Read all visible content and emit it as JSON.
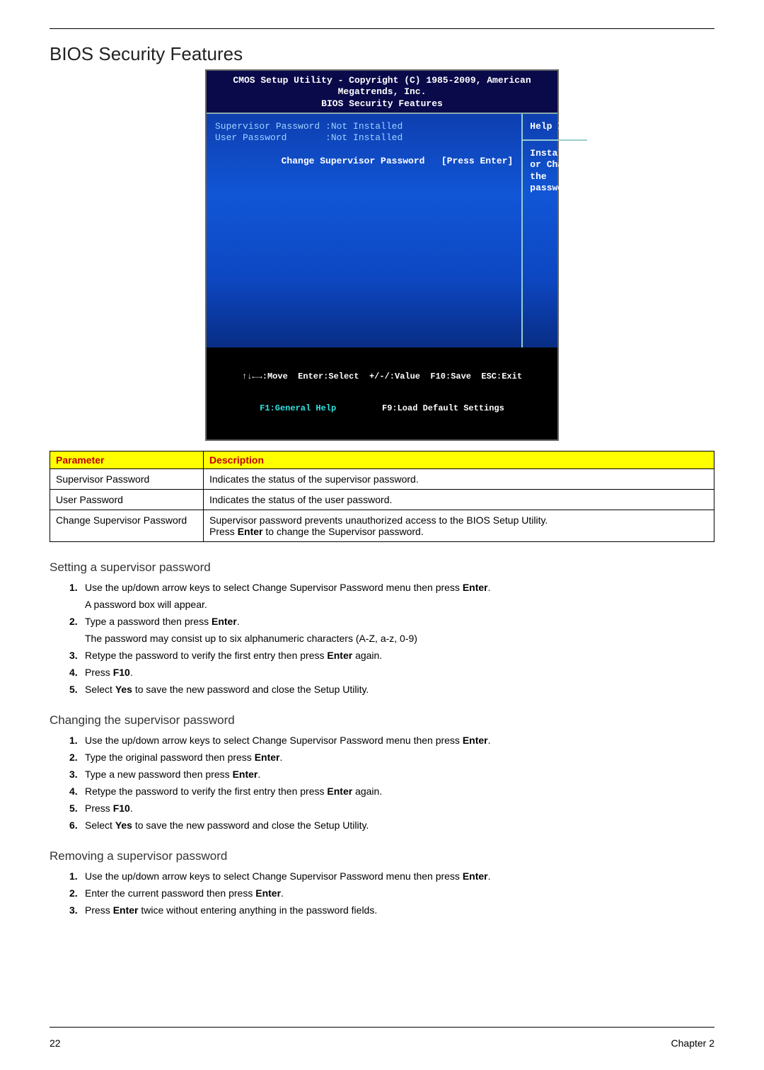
{
  "header": {
    "title": "BIOS Security Features"
  },
  "bios": {
    "top_line1": "CMOS Setup Utility - Copyright (C) 1985-2009, American Megatrends, Inc.",
    "top_line2": "BIOS Security Features",
    "left": {
      "row1": "Supervisor Password :Not Installed",
      "row2": "User Password       :Not Installed",
      "row3_label": "Change Supervisor Password   ",
      "row3_value": "[Press Enter]"
    },
    "right": {
      "head": "Help Item",
      "body": "Install or Change the password."
    },
    "footer": {
      "line1_a": "↑↓←→:Move  Enter:Select  +/-/:Value  F10:Save  ESC:Exit",
      "line2_a": "F1:General Help",
      "line2_b": "F9:Load Default Settings"
    }
  },
  "ptable": {
    "header_param": "Parameter",
    "header_desc": "Description",
    "rows": [
      {
        "param": "Supervisor Password",
        "desc": "Indicates the status of the supervisor password."
      },
      {
        "param": "User Password",
        "desc": "Indicates the status of the user password."
      },
      {
        "param": "Change Supervisor Password",
        "desc_pre": "Supervisor password prevents unauthorized access to the BIOS Setup Utility.",
        "desc_line2_a": "Press ",
        "desc_line2_key": "Enter",
        "desc_line2_b": " to change the Supervisor password."
      }
    ]
  },
  "setting_header": "Setting a supervisor password",
  "setting": {
    "s1_a": "Use the up/down arrow keys to select Change Supervisor Password menu then press ",
    "s1_key": "Enter",
    "s1_b": ".",
    "s1_sub": "A password box will appear.",
    "s2_a": "Type a password then press ",
    "s2_key": "Enter",
    "s2_b": ".",
    "s2_sub": "The password may consist up to six alphanumeric characters (A-Z, a-z, 0-9)",
    "s3_a": "Retype the password to verify the first entry then press ",
    "s3_key": "Enter",
    "s3_b": " again.",
    "s4_a": "Press ",
    "s4_key": "F10",
    "s4_b": ".",
    "s5_a": "Select ",
    "s5_key": "Yes",
    "s5_b": " to save the new password and close the Setup Utility."
  },
  "changing_header": "Changing the supervisor password",
  "changing": {
    "c1_a": "Use the up/down arrow keys to select Change Supervisor Password menu then press ",
    "c1_key": "Enter",
    "c1_b": ".",
    "c2_a": "Type the original password then press ",
    "c2_key": "Enter",
    "c2_b": ".",
    "c3_a": "Type a new password then press ",
    "c3_key": "Enter",
    "c3_b": ".",
    "c4_a": "Retype the password to verify the first entry then press ",
    "c4_key": "Enter",
    "c4_b": " again.",
    "c5_a": "Press ",
    "c5_key": "F10",
    "c5_b": ".",
    "c6_a": "Select ",
    "c6_key": "Yes",
    "c6_b": " to save the new password and close the Setup Utility."
  },
  "removing_header": "Removing a supervisor password",
  "removing": {
    "r1_a": "Use the up/down arrow keys to select Change Supervisor Password menu then press ",
    "r1_key": "Enter",
    "r1_b": ".",
    "r2_a": "Enter the current password then press ",
    "r2_key": "Enter",
    "r2_b": ".",
    "r3_a": "Press ",
    "r3_key": "Enter",
    "r3_b": " twice without entering anything in the password fields."
  },
  "footer": {
    "page": "22",
    "chapter": "Chapter 2"
  },
  "markers": {
    "n1": "1.",
    "n2": "2.",
    "n3": "3.",
    "n4": "4.",
    "n5": "5.",
    "n6": "6."
  }
}
